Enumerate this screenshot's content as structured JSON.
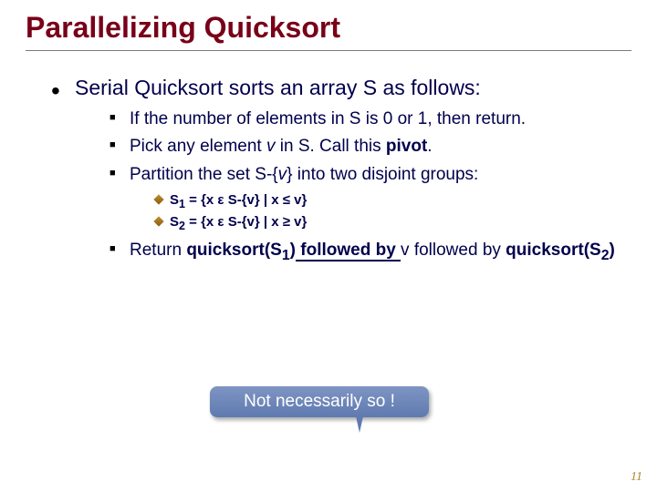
{
  "title": "Parallelizing Quicksort",
  "main": {
    "intro": "Serial Quicksort sorts an array S as follows:",
    "step1": "If the number of elements in S is 0 or 1, then return.",
    "step2_a": "Pick any element ",
    "step2_v": "v ",
    "step2_b": "in S. Call this ",
    "step2_pivot": "pivot",
    "step2_c": ".",
    "step3_a": "Partition the set S-{",
    "step3_v": "v",
    "step3_b": "} into two disjoint groups:",
    "s1_a": "S",
    "s1_sub": "1",
    "s1_b": " = {x ε S-{v} | x ≤ v}",
    "s2_a": "S",
    "s2_sub": "2",
    "s2_b": " = {x ε S-{v} | x ≥ v}",
    "step4_a": "Return ",
    "step4_q1": "quicksort(S",
    "step4_q1sub": "1",
    "step4_q1b": ")",
    "step4_fb": " followed by ",
    "step4_v": "v followed by ",
    "step4_q2": "quicksort(S",
    "step4_q2sub": "2",
    "step4_q2b": ")"
  },
  "callout": "Not necessarily so !",
  "page": "11"
}
